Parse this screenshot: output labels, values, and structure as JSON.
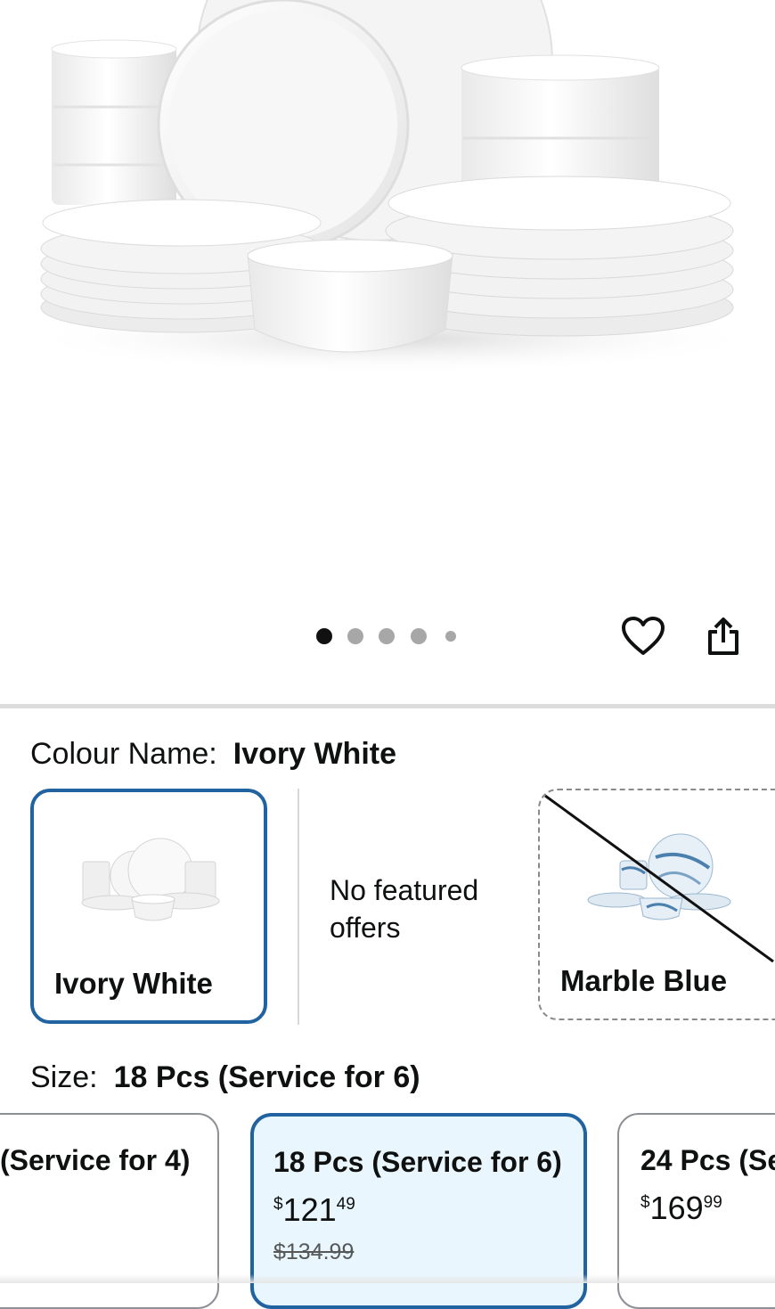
{
  "carousel": {
    "total": 5,
    "active": 0
  },
  "actions": {
    "wishlist_icon": "heart-outline-icon",
    "share_icon": "share-icon"
  },
  "colour": {
    "label": "Colour Name:",
    "selected": "Ivory White",
    "options": [
      {
        "name": "Ivory White",
        "state": "selected"
      },
      {
        "name": "No featured offers",
        "state": "info"
      },
      {
        "name": "Marble Blue",
        "state": "unavailable"
      }
    ]
  },
  "size": {
    "label": "Size:",
    "selected": "18 Pcs (Service for 6)",
    "options": [
      {
        "title": "(Service for 4)",
        "price_whole": "",
        "price_fraction": "",
        "currency": ""
      },
      {
        "title": "18 Pcs (Service for 6)",
        "currency": "$",
        "price_whole": "121",
        "price_fraction": "49",
        "list_price": "$134.99"
      },
      {
        "title": "24 Pcs (Se",
        "currency": "$",
        "price_whole": "169",
        "price_fraction": "99"
      }
    ]
  },
  "colors": {
    "accent": "#2162a1",
    "selected_bg": "#eaf6fe",
    "divider": "#dcdcdc"
  }
}
